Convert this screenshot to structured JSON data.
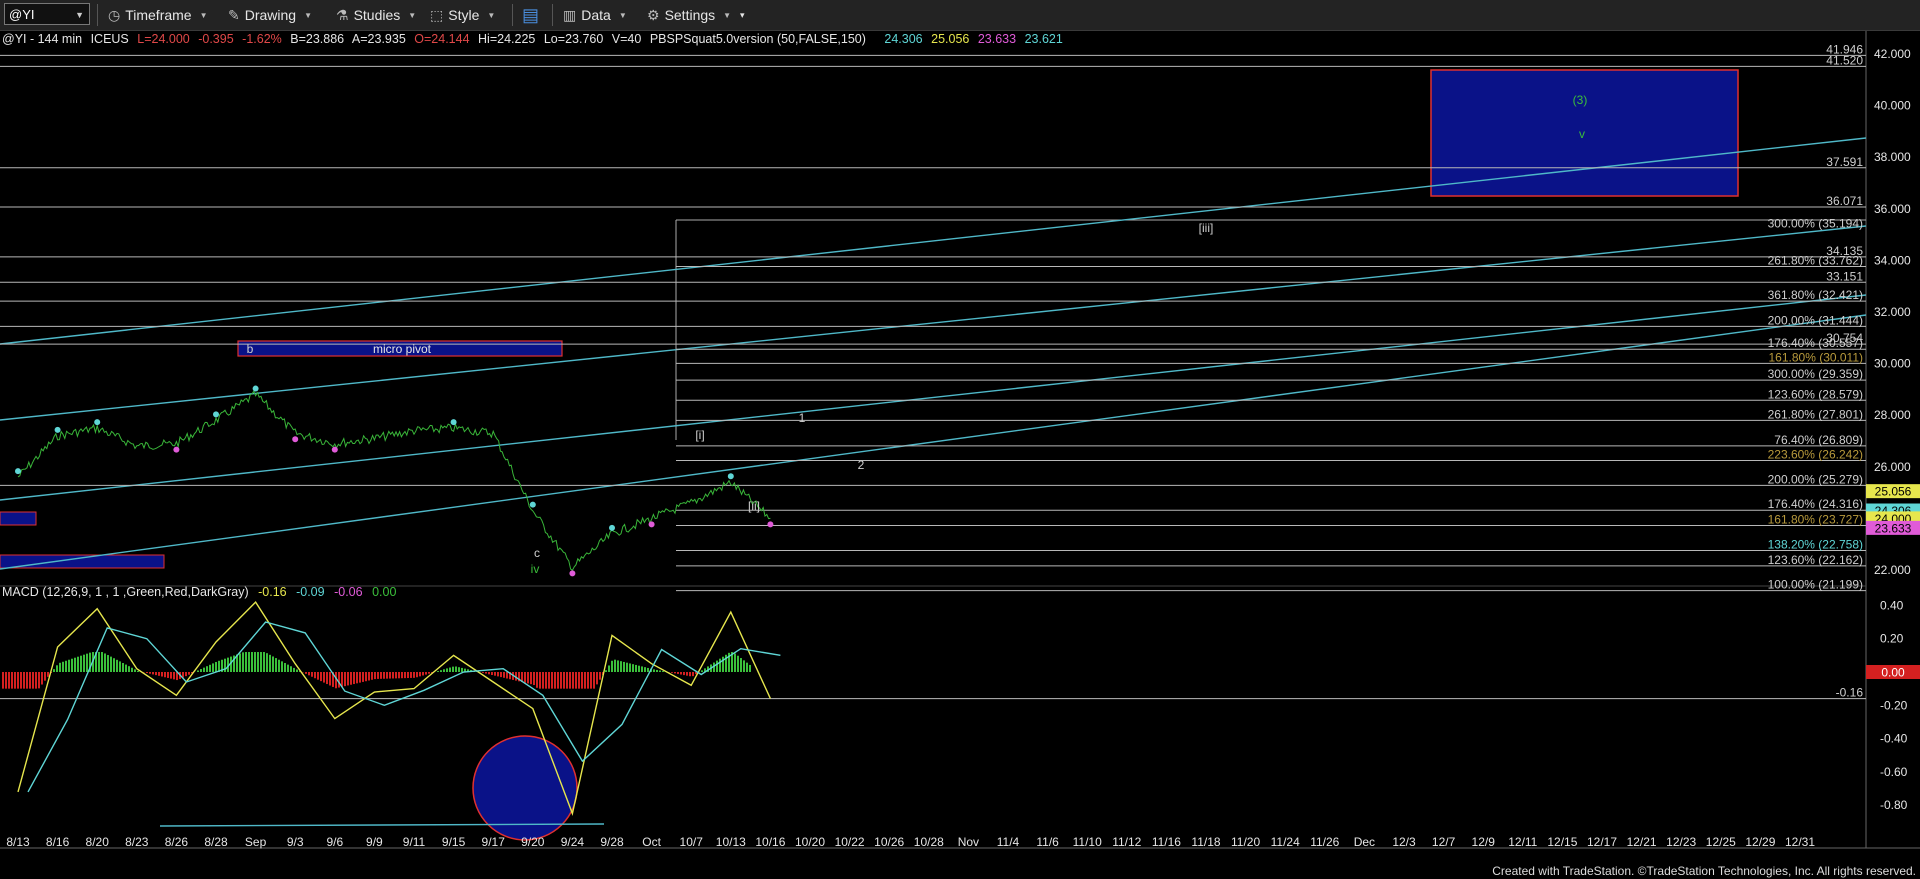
{
  "toolbar": {
    "symbol": "@YI",
    "timeframe_label": "Timeframe",
    "drawing_label": "Drawing",
    "studies_label": "Studies",
    "style_label": "Style",
    "data_label": "Data",
    "settings_label": "Settings"
  },
  "info_bar": {
    "symbol": "@YI - 144 min",
    "exchange": "ICEUS",
    "last": "L=24.000",
    "change": "-0.395",
    "change_pct": "-1.62%",
    "bid": "B=23.886",
    "ask": "A=23.935",
    "open": "O=24.144",
    "high": "Hi=24.225",
    "low": "Lo=23.760",
    "volume": "V=40",
    "study": "PBSPSquat5.0version (50,FALSE,150)",
    "study_values": [
      "24.306",
      "25.056",
      "23.633",
      "23.621"
    ],
    "study_colors": [
      "#5fd6d6",
      "#e6e64d",
      "#e05bd8",
      "#5fd6d6"
    ]
  },
  "macd_info": {
    "label": "MACD (12,26,9, 1 , 1 ,Green,Red,DarkGray)",
    "values": [
      "-0.16",
      "-0.09",
      "-0.06",
      "0.00"
    ],
    "colors": [
      "#e6e64d",
      "#5fd6d6",
      "#e05bd8",
      "#3bbf3b"
    ]
  },
  "footer": {
    "text": "Created with TradeStation. ©TradeStation Technologies, Inc. All rights reserved."
  },
  "chart_data": {
    "type": "line",
    "title": "@YI - 144 min",
    "x_ticks": [
      "8/13",
      "8/16",
      "8/20",
      "8/23",
      "8/26",
      "8/28",
      "Sep",
      "9/3",
      "9/6",
      "9/9",
      "9/11",
      "9/15",
      "9/17",
      "9/20",
      "9/24",
      "9/28",
      "Oct",
      "10/7",
      "10/13",
      "10/16",
      "10/20",
      "10/22",
      "10/26",
      "10/28",
      "Nov",
      "11/4",
      "11/6",
      "11/10",
      "11/12",
      "11/16",
      "11/18",
      "11/20",
      "11/24",
      "11/26",
      "Dec",
      "12/3",
      "12/7",
      "12/9",
      "12/11",
      "12/15",
      "12/17",
      "12/21",
      "12/23",
      "12/25",
      "12/29",
      "12/31"
    ],
    "price_axis": {
      "ticks": [
        "42.000",
        "40.000",
        "38.000",
        "36.000",
        "34.000",
        "32.000",
        "30.000",
        "28.000",
        "26.000",
        "24.000",
        "22.000"
      ],
      "range": [
        20.5,
        42.8
      ]
    },
    "macd_axis": {
      "ticks": [
        "0.40",
        "0.20",
        "0.00",
        "-0.20",
        "-0.40",
        "-0.60",
        "-0.80"
      ],
      "range": [
        -0.93,
        0.52
      ]
    },
    "price_series_approx": [
      {
        "x": "8/13",
        "y": 25.6
      },
      {
        "x": "8/16",
        "y": 27.2
      },
      {
        "x": "8/20",
        "y": 27.5
      },
      {
        "x": "8/23",
        "y": 26.8
      },
      {
        "x": "8/26",
        "y": 26.9
      },
      {
        "x": "8/28",
        "y": 27.8
      },
      {
        "x": "Sep",
        "y": 28.8
      },
      {
        "x": "9/3",
        "y": 27.3
      },
      {
        "x": "9/6",
        "y": 26.9
      },
      {
        "x": "9/9",
        "y": 27.1
      },
      {
        "x": "9/11",
        "y": 27.4
      },
      {
        "x": "9/15",
        "y": 27.5
      },
      {
        "x": "9/17",
        "y": 27.3
      },
      {
        "x": "9/20",
        "y": 24.3
      },
      {
        "x": "9/24",
        "y": 22.1
      },
      {
        "x": "9/28",
        "y": 23.4
      },
      {
        "x": "Oct",
        "y": 24.0
      },
      {
        "x": "10/7",
        "y": 24.6
      },
      {
        "x": "10/13",
        "y": 25.4
      },
      {
        "x": "10/16",
        "y": 24.0
      }
    ],
    "macd_series_approx": [
      {
        "x": "8/13",
        "y": -0.72
      },
      {
        "x": "8/16",
        "y": 0.15
      },
      {
        "x": "8/20",
        "y": 0.38
      },
      {
        "x": "8/23",
        "y": 0.02
      },
      {
        "x": "8/26",
        "y": -0.14
      },
      {
        "x": "8/28",
        "y": 0.18
      },
      {
        "x": "Sep",
        "y": 0.42
      },
      {
        "x": "9/3",
        "y": 0.05
      },
      {
        "x": "9/6",
        "y": -0.28
      },
      {
        "x": "9/9",
        "y": -0.12
      },
      {
        "x": "9/11",
        "y": -0.1
      },
      {
        "x": "9/15",
        "y": 0.1
      },
      {
        "x": "9/17",
        "y": -0.06
      },
      {
        "x": "9/20",
        "y": -0.22
      },
      {
        "x": "9/24",
        "y": -0.85
      },
      {
        "x": "9/28",
        "y": 0.22
      },
      {
        "x": "Oct",
        "y": 0.05
      },
      {
        "x": "10/7",
        "y": -0.08
      },
      {
        "x": "10/13",
        "y": 0.36
      },
      {
        "x": "10/16",
        "y": -0.16
      }
    ],
    "right_axis_labels": [
      {
        "text": "41.946",
        "y": 41.946
      },
      {
        "text": "41.520",
        "y": 41.52
      },
      {
        "text": "37.591",
        "y": 37.591
      },
      {
        "text": "36.071",
        "y": 36.071
      },
      {
        "text": "34.135",
        "y": 34.135
      },
      {
        "text": "33.151",
        "y": 33.151
      },
      {
        "text": "30.754",
        "y": 30.754
      }
    ],
    "fib_levels": [
      {
        "text": "300.00% (35.194)",
        "y": 35.194,
        "color": "#cfcfcf"
      },
      {
        "text": "261.80% (33.762)",
        "y": 33.762,
        "color": "#cfcfcf"
      },
      {
        "text": "361.80% (32.421)",
        "y": 32.421,
        "color": "#cfcfcf"
      },
      {
        "text": "200.00% (31.444)",
        "y": 31.444,
        "color": "#cfcfcf"
      },
      {
        "text": "176.40% (30.557)",
        "y": 30.557,
        "color": "#cfcfcf"
      },
      {
        "text": "161.80% (30.011)",
        "y": 30.011,
        "color": "#b89a3c"
      },
      {
        "text": "300.00% (29.359)",
        "y": 29.359,
        "color": "#cfcfcf"
      },
      {
        "text": "123.60% (28.579)",
        "y": 28.579,
        "color": "#cfcfcf"
      },
      {
        "text": "261.80% (27.801)",
        "y": 27.801,
        "color": "#cfcfcf"
      },
      {
        "text": "76.40% (26.809)",
        "y": 26.809,
        "color": "#cfcfcf"
      },
      {
        "text": "223.60% (26.242)",
        "y": 26.242,
        "color": "#b89a3c"
      },
      {
        "text": "200.00% (25.279)",
        "y": 25.279,
        "color": "#cfcfcf"
      },
      {
        "text": "176.40% (24.316)",
        "y": 24.316,
        "color": "#cfcfcf"
      },
      {
        "text": "161.80% (23.727)",
        "y": 23.727,
        "color": "#b89a3c"
      },
      {
        "text": "138.20% (22.758)",
        "y": 22.758,
        "color": "#5fd6d6"
      },
      {
        "text": "123.60% (22.162)",
        "y": 22.162,
        "color": "#cfcfcf"
      },
      {
        "text": "100.00% (21.199)",
        "y": 21.199,
        "color": "#cfcfcf"
      }
    ],
    "price_tags": [
      {
        "text": "25.056",
        "y": 25.056,
        "bg": "#e6e64d",
        "fg": "#000"
      },
      {
        "text": "24.306",
        "y": 24.306,
        "bg": "#5fd6d6",
        "fg": "#000"
      },
      {
        "text": "24.000",
        "y": 24.0,
        "bg": "#e6e64d",
        "fg": "#000"
      },
      {
        "text": "23.633",
        "y": 23.633,
        "bg": "#e05bd8",
        "fg": "#000"
      }
    ],
    "macd_tags": [
      {
        "text": "0.00",
        "y": 0.0,
        "bg": "#d42020",
        "fg": "#fff"
      }
    ],
    "macd_level_label": {
      "text": "-0.16",
      "y": -0.16
    },
    "wave_labels": [
      {
        "text": "(3)",
        "color": "#3bbf3b"
      },
      {
        "text": "v",
        "color": "#3bbf3b"
      },
      {
        "text": "[iii]",
        "color": "#cfcfcf"
      },
      {
        "text": "[i]",
        "color": "#cfcfcf"
      },
      {
        "text": "[ii]",
        "color": "#cfcfcf"
      },
      {
        "text": "b",
        "color": "#cfcfcf"
      },
      {
        "text": "micro pivot",
        "color": "#e6e6e6"
      },
      {
        "text": "c",
        "color": "#cfcfcf"
      },
      {
        "text": "iv",
        "color": "#3bbf3b"
      },
      {
        "text": "1",
        "color": "#cfcfcf"
      },
      {
        "text": "2",
        "color": "#cfcfcf"
      }
    ],
    "grid": false
  }
}
